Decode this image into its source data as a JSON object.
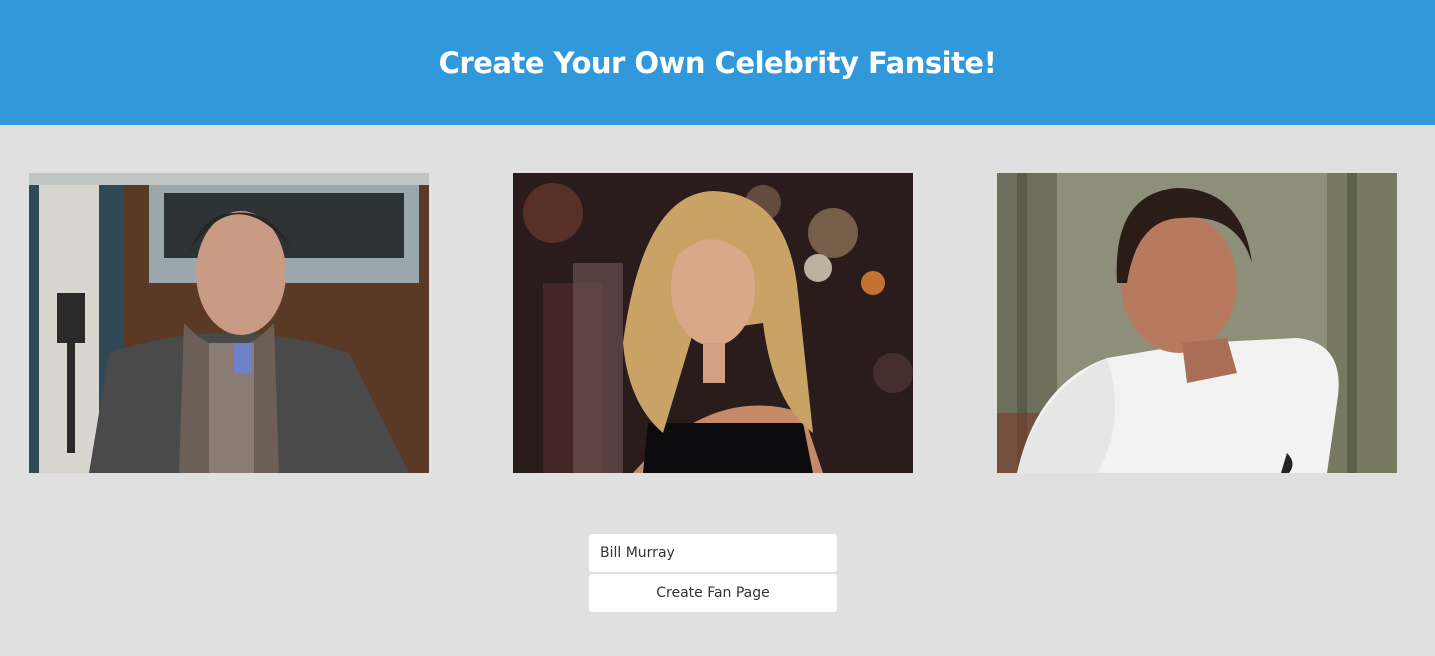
{
  "header": {
    "title": "Create Your Own Celebrity Fansite!",
    "background": "#3199db"
  },
  "gallery": {
    "photos": [
      {
        "icon": "celebrity-photo-icon"
      },
      {
        "icon": "celebrity-photo-icon"
      },
      {
        "icon": "celebrity-photo-icon"
      }
    ]
  },
  "form": {
    "name_value": "Bill Murray",
    "submit_label": "Create Fan Page"
  },
  "colors": {
    "page_background": "#e0e0e0",
    "header_background": "#3199db"
  }
}
